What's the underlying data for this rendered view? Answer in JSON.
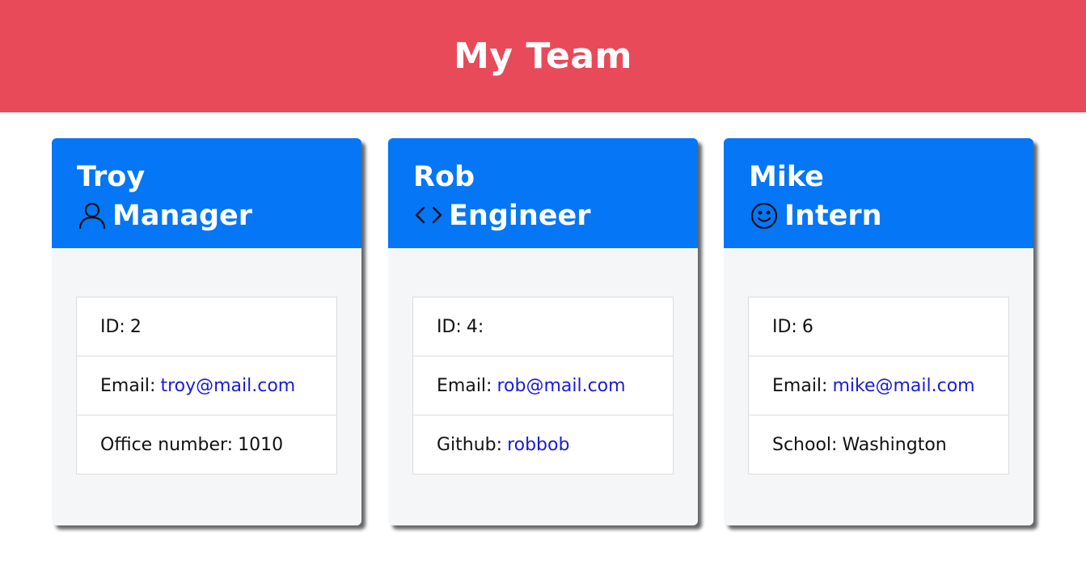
{
  "header": {
    "title": "My Team"
  },
  "employees": [
    {
      "name": "Troy",
      "role": "Manager",
      "role_icon": "person-icon",
      "id_label": "ID:",
      "id_value": "2",
      "email_label": "Email:",
      "email": "troy@mail.com",
      "extra_label": "Office number:",
      "extra_value": "1010"
    },
    {
      "name": "Rob",
      "role": "Engineer",
      "role_icon": "code-icon",
      "id_label": "ID:",
      "id_value": "4:",
      "email_label": "Email:",
      "email": "rob@mail.com",
      "extra_label": "Github:",
      "extra_value": "robbob"
    },
    {
      "name": "Mike",
      "role": "Intern",
      "role_icon": "smiley-icon",
      "id_label": "ID:",
      "id_value": "6",
      "email_label": "Email:",
      "email": "mike@mail.com",
      "extra_label": "School:",
      "extra_value": "Washington"
    }
  ],
  "colors": {
    "header_bg": "#e84a5a",
    "card_head_bg": "#0576f5",
    "card_body_bg": "#f5f6f8",
    "link": "#1a1adc"
  }
}
